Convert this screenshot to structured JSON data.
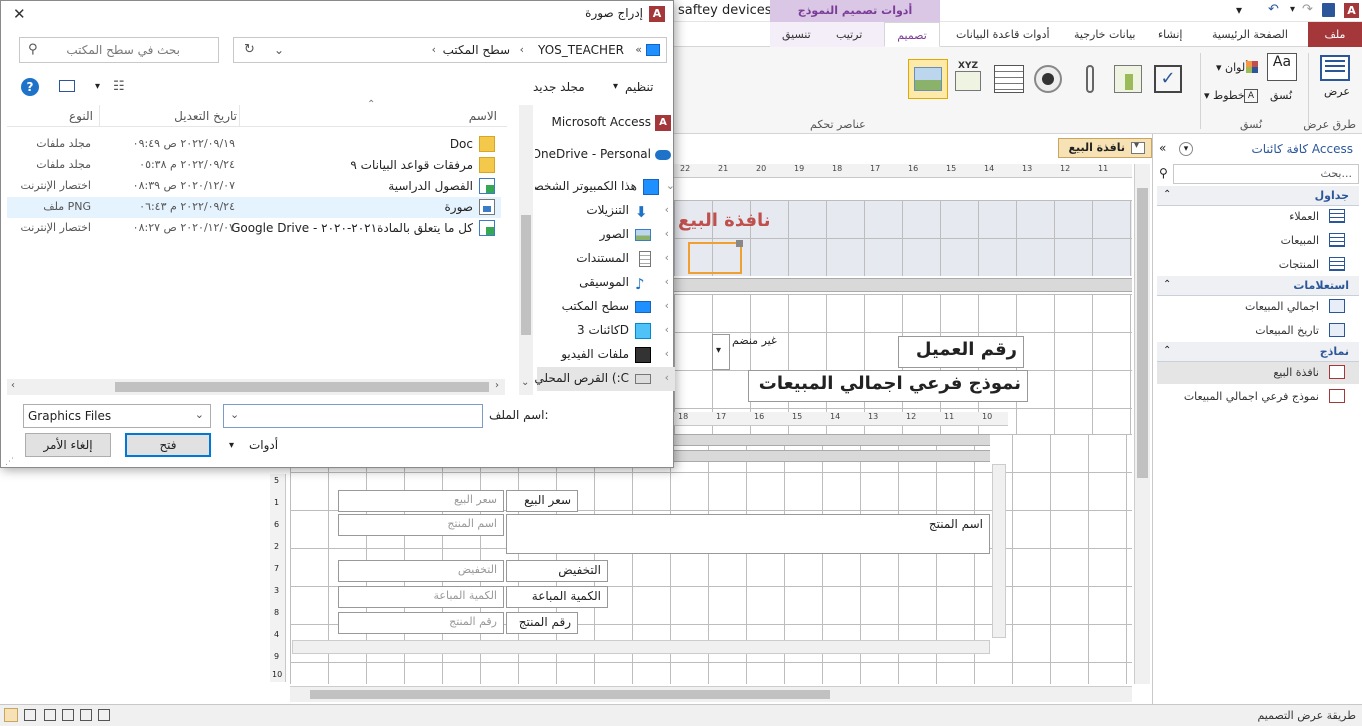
{
  "app": {
    "doc_title": "saftey devices",
    "context_tab_group": "أدوات تصميم النموذج"
  },
  "ribbon": {
    "tabs": [
      "ملف",
      "الصفحة الرئيسية",
      "إنشاء",
      "بيانات خارجية",
      "أدوات قاعدة البيانات",
      "تصميم",
      "ترتيب",
      "تنسيق"
    ],
    "groups": {
      "views": "طرق عرض",
      "themes": "نُسق",
      "controls": "عناصر تحكم"
    },
    "views_btn": "عرض",
    "themes_btn": "نُسق",
    "colors_btn": "ألوان",
    "fonts_btn": "خطوط"
  },
  "navpane": {
    "title": "كافة كائنات Access",
    "search_placeholder": "بحث...",
    "categories": [
      {
        "name": "جداول",
        "items": [
          "العملاء",
          "المبيعات",
          "المنتجات"
        ]
      },
      {
        "name": "استعلامات",
        "items": [
          "اجمالي المبيعات",
          "تاريخ المبيعات"
        ]
      },
      {
        "name": "نماذج",
        "items": [
          "نافذة البيع",
          "نموذج فرعي اجمالي المبيعات"
        ]
      }
    ]
  },
  "design": {
    "doc_tab": "نافذة البيع",
    "header_label": "نافذة البيع",
    "customer_label": "رقم العميل",
    "unbound": "غير منضم",
    "subform_label": "نموذج فرعي اجمالي المبيعات",
    "sub_fields": [
      {
        "label": "سعر البيع",
        "field": "سعر البيع"
      },
      {
        "label": "اسم المنتج",
        "field": "اسم المنتج"
      },
      {
        "label": "التخفيض",
        "field": "التخفيض"
      },
      {
        "label": "الكمية المباعة",
        "field": "الكمية المباعة"
      },
      {
        "label": "رقم المنتج",
        "field": "رقم المنتج"
      }
    ],
    "ruler_top": [
      "22",
      "21",
      "20",
      "19",
      "18",
      "17",
      "16",
      "15",
      "14",
      "13",
      "12",
      "11"
    ],
    "ruler_sub": [
      "18",
      "17",
      "16",
      "15",
      "14",
      "13",
      "12",
      "11",
      "10",
      "9",
      "8",
      "7",
      "6",
      "5",
      "4",
      "3",
      "2",
      "1"
    ],
    "ruler_left": [
      "5",
      "1",
      "6",
      "2",
      "7",
      "3",
      "8",
      "4",
      "9",
      "10"
    ]
  },
  "status": {
    "text": "طريقة عرض التصميم"
  },
  "dialog": {
    "title": "إدراج صورة",
    "breadcrumb": [
      "YOS_TEACHER",
      "سطح المكتب"
    ],
    "search_placeholder": "بحث في سطح المكتب",
    "organize": "تنظيم",
    "new_folder": "مجلد جديد",
    "columns": {
      "name": "الاسم",
      "date": "تاريخ التعديل",
      "type": "النوع"
    },
    "files": [
      {
        "name": "Doc",
        "date": "٢٠٢٢/٠٩/١٩ ص ٠٩:٤٩",
        "type": "مجلد ملفات",
        "kind": "folder"
      },
      {
        "name": "مرفقات قواعد البيانات ٩",
        "date": "٢٠٢٢/٠٩/٢٤ م ٠٥:٣٨",
        "type": "مجلد ملفات",
        "kind": "folder"
      },
      {
        "name": "الفصول الدراسية",
        "date": "٢٠٢٠/١٢/٠٧ ص ٠٨:٣٩",
        "type": "اختصار الإنترنت",
        "kind": "shortcut"
      },
      {
        "name": "صورة",
        "date": "٢٠٢٢/٠٩/٢٤ م ٠٦:٤٣",
        "type": "ملف PNG",
        "kind": "png"
      },
      {
        "name": "Google Drive - كل ما يتعلق بالمادة٢٠٢١-٢٠٢٠",
        "date": "٢٠٢٠/١٢/٠٧ ص ٠٨:٢٧",
        "type": "اختصار الإنترنت",
        "kind": "shortcut"
      }
    ],
    "tree": [
      {
        "name": "Microsoft Access",
        "icon": "access-icon"
      },
      {
        "name": "OneDrive - Personal",
        "icon": "onedrive-icon"
      },
      {
        "name": "هذا الكمبيوتر الشخصي",
        "icon": "pc-icon"
      },
      {
        "name": "التنزيلات",
        "icon": "download-icon"
      },
      {
        "name": "الصور",
        "icon": "pictures-icon"
      },
      {
        "name": "المستندات",
        "icon": "documents-icon"
      },
      {
        "name": "الموسيقى",
        "icon": "music-icon"
      },
      {
        "name": "سطح المكتب",
        "icon": "desktop-icon"
      },
      {
        "name": "كائنات 3D",
        "icon": "3d-icon"
      },
      {
        "name": "ملفات الفيديو",
        "icon": "video-icon"
      },
      {
        "name": "القرص المحلي (:C",
        "icon": "drive-icon"
      }
    ],
    "filename_label": "اسم الملف:",
    "filename_value": "",
    "filter": "Graphics Files",
    "tools": "أدوات",
    "open": "فتح",
    "cancel": "إلغاء الأمر"
  },
  "colors": {
    "file_tab": "#a4373a",
    "accent": "#7b3c98",
    "access_red": "#c0504d",
    "nav_blue": "#2b579a"
  }
}
